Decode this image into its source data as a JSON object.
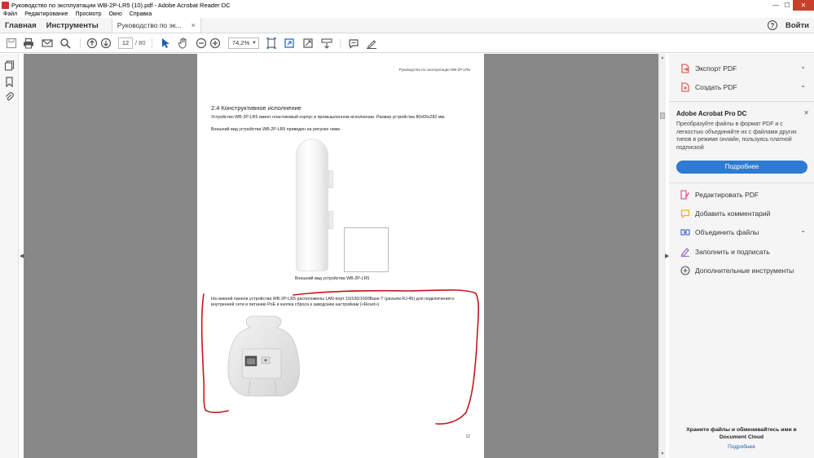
{
  "window": {
    "title": "Руководство по эксплуатации WB-2P-LR5 (10).pdf - Adobe Acrobat Reader DC",
    "min": "—",
    "max": "☐",
    "close": "✕"
  },
  "menu": [
    "Файл",
    "Редактирование",
    "Просмотр",
    "Окно",
    "Справка"
  ],
  "tabs": {
    "home": "Главная",
    "tools": "Инструменты",
    "document": "Руководство по эк...",
    "close": "×",
    "help": "?",
    "signin": "Войти"
  },
  "toolbar": {
    "page_current": "12",
    "page_total": "/ 80",
    "zoom": "74,2%",
    "zoom_arrow": "▼"
  },
  "document": {
    "header": "Руководство по эксплуатации WB-2P-LR5",
    "section_title": "2.4  Конструктивное исполнение",
    "para1": "Устройство WB-2P-LR5 имеет пластиковый корпус в промышленном исполнении. Размер устройства 80x66x282 мм.",
    "para2": "Внешний вид устройства WB-2P-LR5 приведен на рисунке ниже.",
    "caption": "Внешний вид устройства WB-2P-LR5",
    "para3": "На нижней панели устройства WB-2P-LR5 расположены LAN-порт 10/100/1000Base-T (разъем RJ-45) для подключения к внутренней сети и питанию PoE и кнопка сброса к заводским настройкам («Reset»).",
    "page_number": "12"
  },
  "scroll": {
    "up": "▲",
    "down": "▼"
  },
  "collapse": {
    "left": "◀",
    "right": "▶"
  },
  "rightpane": {
    "export_pdf": "Экспорт PDF",
    "create_pdf": "Создать PDF",
    "chevron": "⌄",
    "promo_title": "Adobe Acrobat Pro DC",
    "promo_close": "✕",
    "promo_text": "Преобразуйте файлы в формат PDF и с легкостью объединяйте их с файлами других типов в режиме онлайн, пользуясь платной подпиской",
    "promo_button": "Подробнее",
    "tools": [
      {
        "label": "Редактировать PDF",
        "icon": "edit-pdf-icon",
        "color": "#e04b8c"
      },
      {
        "label": "Добавить комментарий",
        "icon": "comment-icon",
        "color": "#f2b01e"
      },
      {
        "label": "Объединить файлы",
        "icon": "combine-icon",
        "color": "#3b62c4"
      },
      {
        "label": "Заполнить и подписать",
        "icon": "sign-icon",
        "color": "#8a58c9"
      },
      {
        "label": "Дополнительные инструменты",
        "icon": "more-tools-icon",
        "color": "#555555"
      }
    ],
    "cloud_text_line1": "Храните файлы и обменивайтесь ими в",
    "cloud_text_line2": "Document Cloud",
    "cloud_link": "Подробнее"
  },
  "colors": {
    "accent": "#2d7bd2",
    "export_icon": "#d84a3a",
    "create_icon": "#d84a3a",
    "annotation": "#c41818"
  }
}
